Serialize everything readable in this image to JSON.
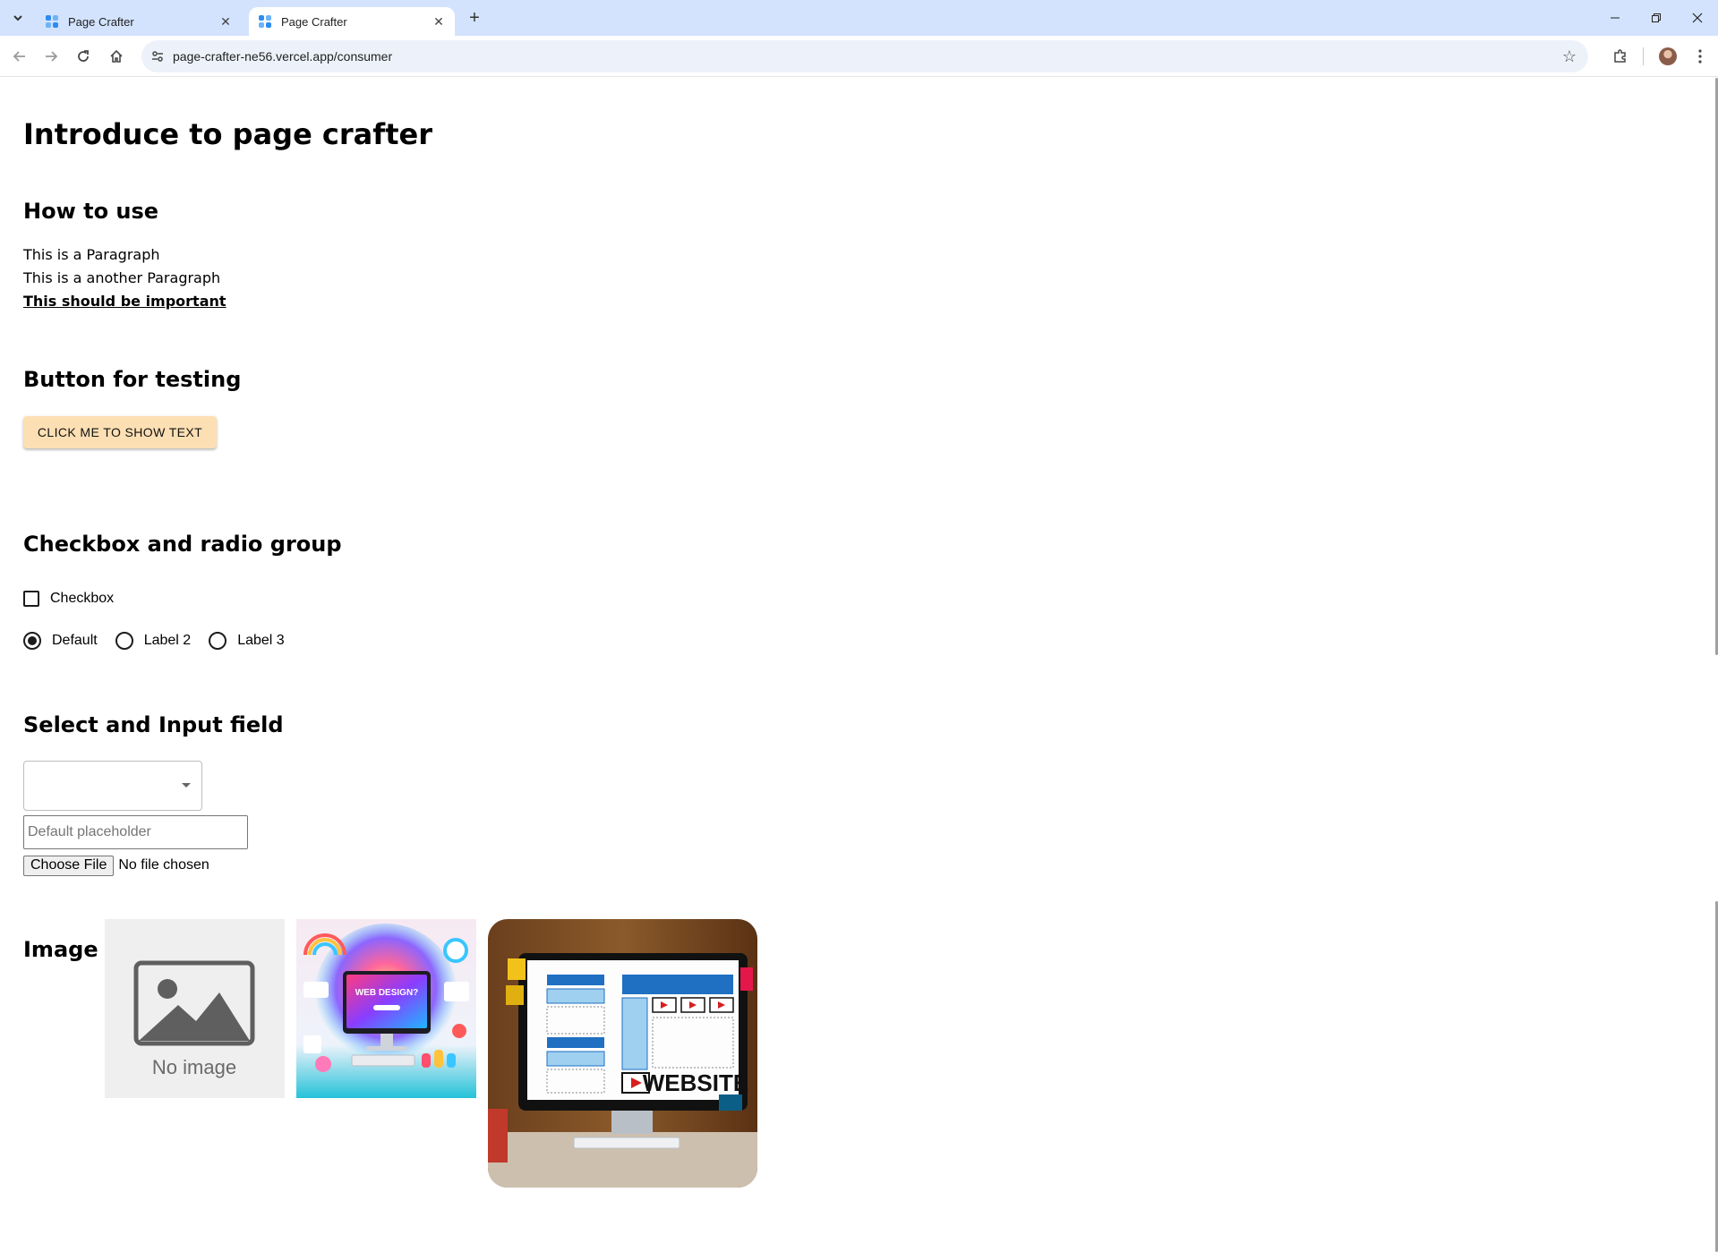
{
  "browser": {
    "tabs": [
      {
        "title": "Page Crafter",
        "active": false
      },
      {
        "title": "Page Crafter",
        "active": true
      }
    ],
    "url": "page-crafter-ne56.vercel.app/consumer"
  },
  "page": {
    "title": "Introduce to page crafter",
    "how_to_use": {
      "heading": "How to use",
      "paragraph_1": "This is a Paragraph",
      "paragraph_2": "This is a another Paragraph",
      "important": "This should be important"
    },
    "button_section": {
      "heading": "Button for testing",
      "button_label": "CLICK ME TO SHOW TEXT",
      "button_color": "#fddfb4"
    },
    "checkbox_section": {
      "heading": "Checkbox and radio group",
      "checkbox_label": "Checkbox",
      "checkbox_checked": false,
      "radio_options": [
        "Default",
        "Label 2",
        "Label 3"
      ],
      "radio_selected": "Default"
    },
    "input_section": {
      "heading": "Select and Input field",
      "select_value": "",
      "input_value": "",
      "input_placeholder": "Default placeholder",
      "file_button": "Choose File",
      "file_status": "No file chosen"
    },
    "image_section": {
      "heading": "Image",
      "placeholder_text": "No image",
      "website_text": "WEBSITE",
      "webdesign_text": "WEB DESIGN?"
    }
  }
}
